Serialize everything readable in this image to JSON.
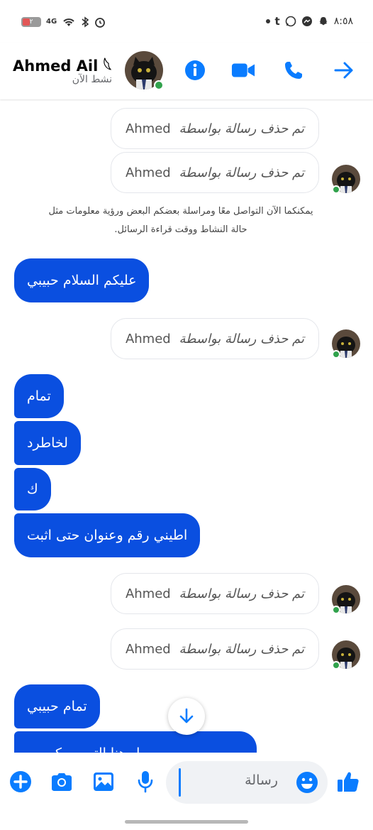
{
  "status_bar": {
    "battery_label": "٢",
    "network": "4G",
    "time": "٨:٥٨"
  },
  "header": {
    "contact_name": "Ahmed Ail 𓆩",
    "contact_status": "نشط الآن"
  },
  "messages": {
    "deleted_text": "تم حذف رسالة بواسطة",
    "deleted_sender": "Ahmed",
    "system_note": "يمكنكما الآن التواصل معًا ومراسلة بعضكم البعض ورؤية معلومات مثل حالة النشاط ووقت قراءة الرسائل.",
    "sent": [
      "عليكم السلام حبيبي",
      "تمام",
      "لخاطرد",
      "ك",
      "اطيني رقم وعنوان حتى اثبت",
      "تمام حبيبي",
      "ل هنا التي ... كي ..."
    ]
  },
  "composer": {
    "placeholder": "رسالة"
  },
  "colors": {
    "brand_blue": "#0a7cff",
    "bubble_blue": "#0a4fe0",
    "online_green": "#31a24c"
  },
  "icons": [
    "info-icon",
    "video-call-icon",
    "phone-icon",
    "arrow-right-icon",
    "plus-icon",
    "camera-icon",
    "gallery-icon",
    "microphone-icon",
    "emoji-icon",
    "like-icon",
    "arrow-down-icon"
  ]
}
